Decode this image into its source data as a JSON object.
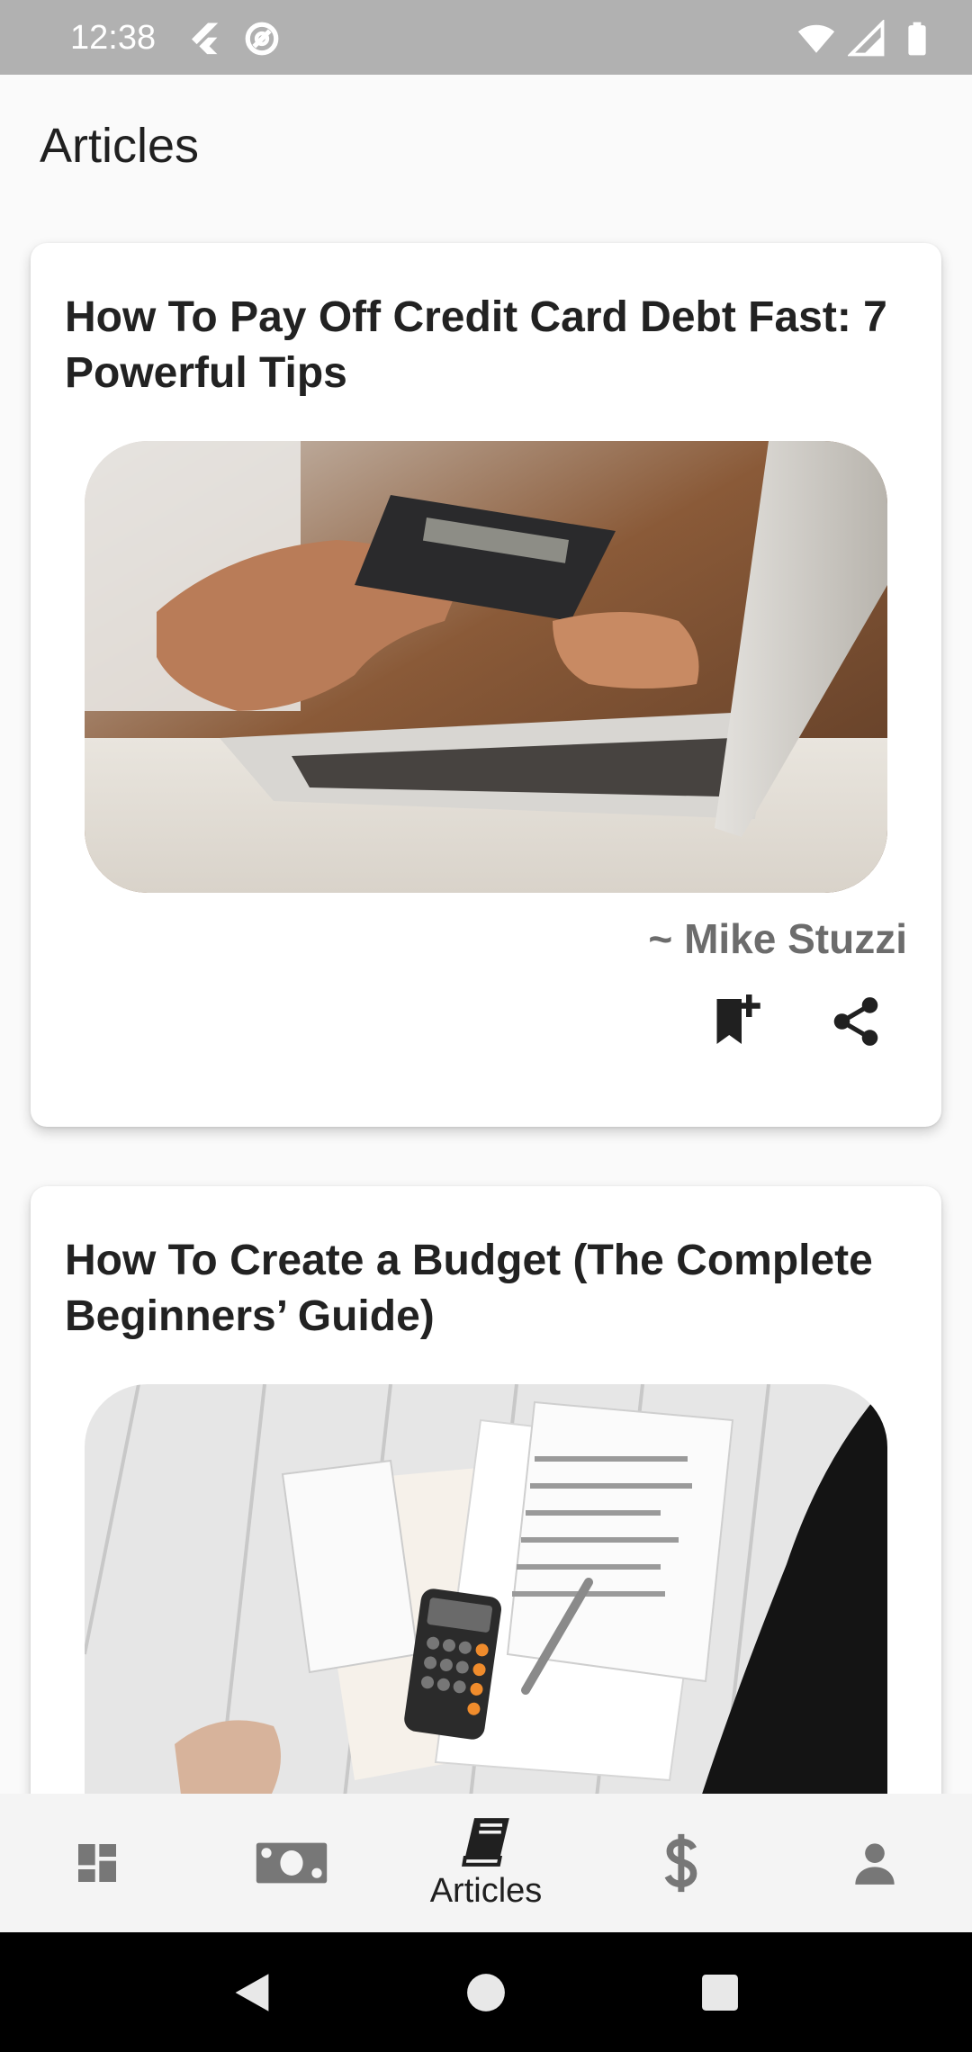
{
  "status_bar": {
    "time": "12:38",
    "icons_left": [
      "flutter-icon",
      "at-sign-icon"
    ],
    "icons_right": [
      "wifi-icon",
      "signal-icon",
      "battery-icon"
    ],
    "background": "#b1b1b1"
  },
  "page": {
    "title": "Articles"
  },
  "articles": [
    {
      "title": "How To Pay Off Credit Card Debt Fast: 7 Powerful Tips",
      "author": "~ Mike Stuzzi",
      "image": "photo of hand holding credit card while typing on laptop",
      "actions": [
        "bookmark-add-icon",
        "share-icon"
      ]
    },
    {
      "title": "How To Create a Budget (The Complete Beginners’ Guide)",
      "image": "photo of tax forms, calculator and pen on white wooden floor"
    }
  ],
  "bottom_nav": {
    "items": [
      {
        "icon": "dashboard-icon",
        "label": ""
      },
      {
        "icon": "money-icon",
        "label": ""
      },
      {
        "icon": "book-icon",
        "label": "Articles",
        "active": true
      },
      {
        "icon": "dollar-icon",
        "label": ""
      },
      {
        "icon": "person-icon",
        "label": ""
      }
    ],
    "inactive_color": "#777777",
    "active_color": "#202020"
  },
  "system_nav": {
    "buttons": [
      "back-icon",
      "home-icon",
      "recents-icon"
    ]
  }
}
